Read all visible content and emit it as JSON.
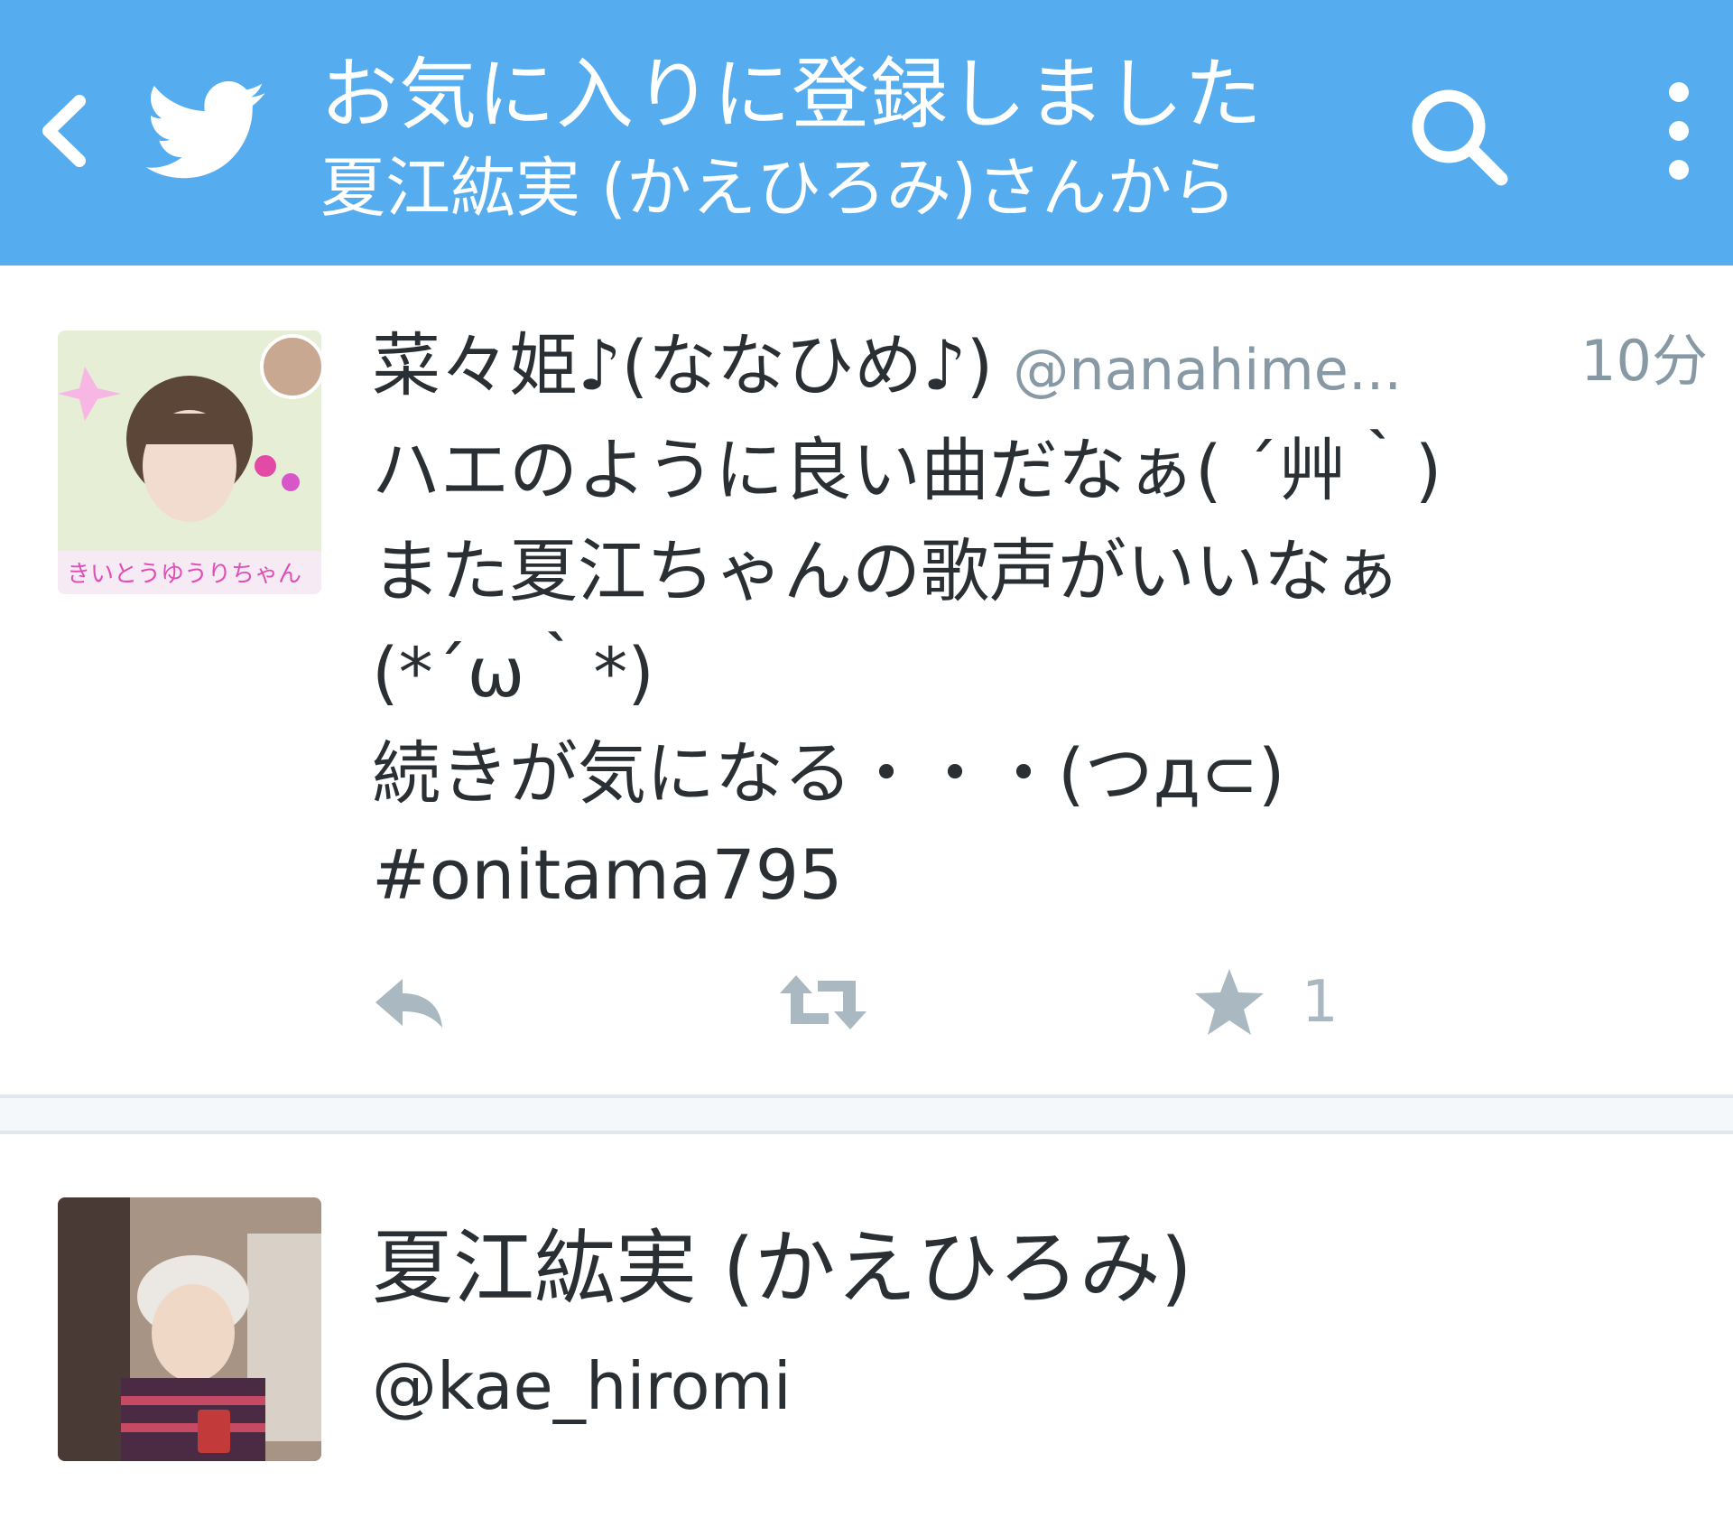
{
  "colors": {
    "header_bg": "#55acee",
    "action_gray": "#aab8c2",
    "secondary_text": "#8899a6"
  },
  "header": {
    "back_icon": "chevron-left-icon",
    "brand_icon": "twitter-bird-icon",
    "title": "お気に入りに登録しました",
    "subtitle": "夏江紘実 (かえひろみ)さんから",
    "search_icon": "search-icon",
    "overflow_icon": "more-vertical-icon"
  },
  "tweet": {
    "display_name": "菜々姫♪(ななひめ♪)",
    "handle": "@nanahime...",
    "time": "10分",
    "text_lines": [
      "ハエのように良い曲だなぁ( ´艸｀)",
      "また夏江ちゃんの歌声がいいなぁ",
      "(*´ω｀*)",
      "続きが気になる・・・(つд⊂)",
      "#onitama795"
    ],
    "actions": {
      "reply_icon": "reply-icon",
      "retweet_icon": "retweet-icon",
      "favorite_icon": "star-icon",
      "favorite_count": "1"
    }
  },
  "profile": {
    "name": "夏江紘実 (かえひろみ)",
    "handle": "@kae_hiromi"
  }
}
